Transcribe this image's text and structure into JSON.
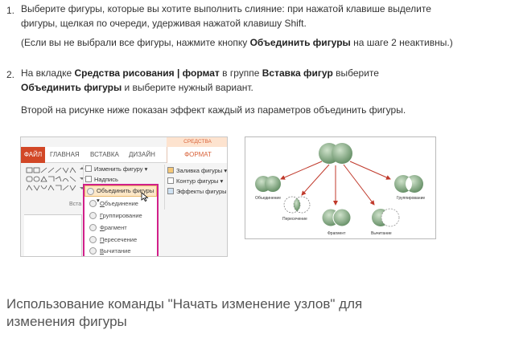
{
  "steps": [
    {
      "number": "1.",
      "text": "Выберите фигуры, которые вы хотите выполнить слияние: при нажатой клавише выделите фигуры, щелкая по очереди, удерживая нажатой клавишу Shift.",
      "note_prefix": "(Если вы не выбрали все фигуры, нажмите кнопку ",
      "note_bold": "Объединить фигуры",
      "note_suffix": " на шаге 2 неактивны.)"
    },
    {
      "number": "2.",
      "t1": "На вкладке ",
      "b1": "Средства рисования | формат",
      "t2": " в группе ",
      "b2": "Вставка фигур",
      "t3": " выберите ",
      "b3": "Объединить фигуры",
      "t4": " и выберите нужный вариант.",
      "note": "Второй на рисунке ниже показан эффект каждый из параметров объединить фигуры."
    }
  ],
  "ribbon": {
    "tab_file": "ФАЙЛ",
    "tab_home": "ГЛАВНАЯ",
    "tab_insert": "ВСТАВКА",
    "tab_design": "ДИЗАЙН",
    "context_header": "СРЕДСТВА РИСОВАНИЯ",
    "context_tab": "ФОРМАТ",
    "edit_shape": "Изменить фигуру ▾",
    "textbox": "Надпись",
    "merge_shapes": "Объединить фигуры ▾",
    "shape_fill": "Заливка фигуры ▾",
    "shape_outline": "Контур фигуры ▾",
    "shape_effects": "Эффекты фигуры ▾",
    "group_label": "Вста",
    "menu_items": [
      {
        "underline": "О",
        "rest": "бъединение"
      },
      {
        "underline": "Г",
        "rest": "руппирование"
      },
      {
        "underline": "Ф",
        "rest": "рагмент"
      },
      {
        "underline": "П",
        "rest": "ересечение"
      },
      {
        "underline": "В",
        "rest": "ычитание"
      }
    ]
  },
  "diagram": {
    "labels": {
      "union": "Объединение",
      "intersect_left": "Пересечение",
      "fragment": "Фрагмент",
      "subtract": "Вычитание",
      "combine": "Группирование"
    },
    "colors": {
      "shape_fill": "#5f8a60",
      "shape_light": "#a9c8a5",
      "arrow": "#c0392b"
    }
  },
  "heading": "Использование команды \"Начать изменение узлов\" для изменения фигуры",
  "accent": {
    "file_tab": "#d24726",
    "context": "#d9633a",
    "highlight_border": "#d1208a"
  }
}
